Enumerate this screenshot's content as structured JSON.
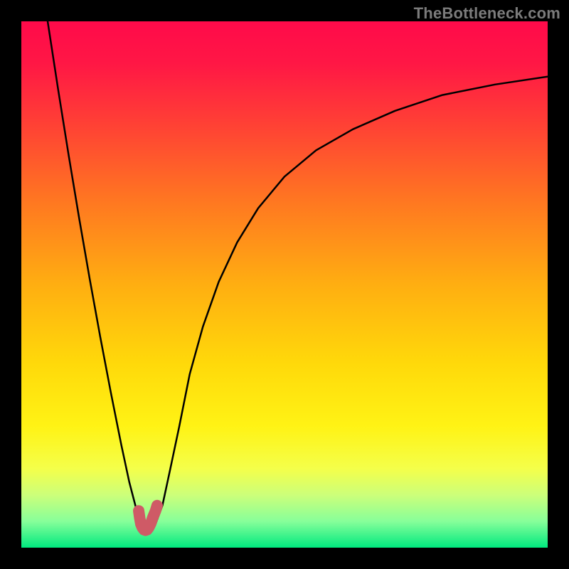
{
  "watermark": "TheBottleneck.com",
  "chart_data": {
    "type": "line",
    "title": "",
    "xlabel": "",
    "ylabel": "",
    "xlim": [
      0.0,
      1.0
    ],
    "ylim": [
      0.0,
      1.0
    ],
    "grid": false,
    "background_gradient_stops": [
      {
        "offset": 0.0,
        "color": "#ff0a4a"
      },
      {
        "offset": 0.08,
        "color": "#ff1745"
      },
      {
        "offset": 0.2,
        "color": "#ff4234"
      },
      {
        "offset": 0.35,
        "color": "#ff7a20"
      },
      {
        "offset": 0.5,
        "color": "#ffae11"
      },
      {
        "offset": 0.65,
        "color": "#ffd90a"
      },
      {
        "offset": 0.77,
        "color": "#fff315"
      },
      {
        "offset": 0.85,
        "color": "#f4ff4a"
      },
      {
        "offset": 0.9,
        "color": "#ccff7a"
      },
      {
        "offset": 0.95,
        "color": "#87ff9a"
      },
      {
        "offset": 1.0,
        "color": "#00e97f"
      }
    ],
    "series": [
      {
        "name": "curve",
        "color": "#000000",
        "stroke_width": 2.5,
        "x": [
          0.05,
          0.07,
          0.09,
          0.11,
          0.13,
          0.15,
          0.17,
          0.19,
          0.205,
          0.218,
          0.23,
          0.243,
          0.255,
          0.268,
          0.282,
          0.3,
          0.32,
          0.345,
          0.375,
          0.41,
          0.45,
          0.5,
          0.56,
          0.63,
          0.71,
          0.8,
          0.9,
          1.0
        ],
        "y": [
          1.0,
          0.87,
          0.745,
          0.625,
          0.51,
          0.4,
          0.295,
          0.195,
          0.125,
          0.075,
          0.045,
          0.035,
          0.045,
          0.08,
          0.145,
          0.23,
          0.33,
          0.42,
          0.505,
          0.58,
          0.645,
          0.705,
          0.755,
          0.795,
          0.83,
          0.86,
          0.88,
          0.895
        ]
      },
      {
        "name": "highlight_u",
        "color": "#cf5a66",
        "stroke_width": 16,
        "x": [
          0.223,
          0.225,
          0.227,
          0.23,
          0.233,
          0.236,
          0.239,
          0.242,
          0.246,
          0.25,
          0.255,
          0.258
        ],
        "y": [
          0.07,
          0.056,
          0.045,
          0.038,
          0.034,
          0.033,
          0.034,
          0.038,
          0.046,
          0.058,
          0.07,
          0.08
        ]
      }
    ]
  }
}
